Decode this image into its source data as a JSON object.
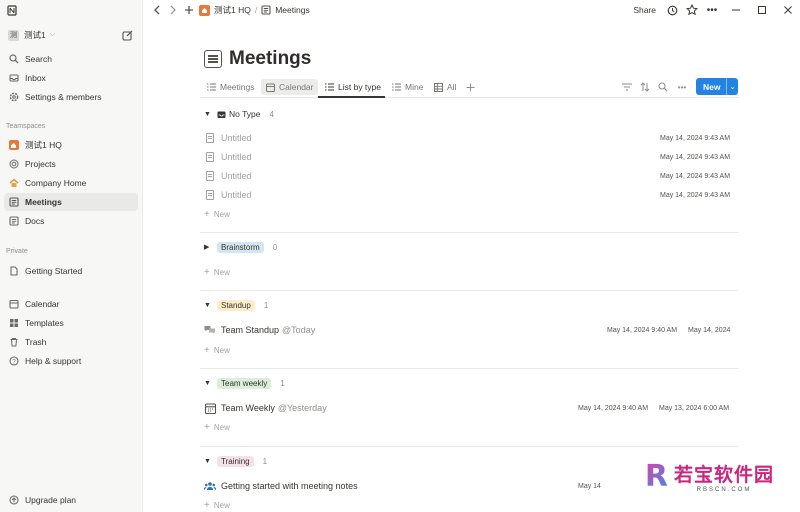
{
  "workspace": {
    "name": "测试1",
    "avatar": "测"
  },
  "sidebar": {
    "top_items": [
      {
        "label": "Search",
        "icon": "search-icon"
      },
      {
        "label": "Inbox",
        "icon": "inbox-icon"
      },
      {
        "label": "Settings & members",
        "icon": "gear-icon"
      }
    ],
    "teamspaces_label": "Teamspaces",
    "teamspace": {
      "label": "测试1 HQ"
    },
    "teamspace_items": [
      {
        "label": "Projects"
      },
      {
        "label": "Company Home"
      },
      {
        "label": "Meetings"
      },
      {
        "label": "Docs"
      }
    ],
    "private_label": "Private",
    "private_items": [
      {
        "label": "Getting Started"
      }
    ],
    "bottom_items": [
      {
        "label": "Calendar"
      },
      {
        "label": "Templates"
      },
      {
        "label": "Trash"
      },
      {
        "label": "Help & support"
      }
    ],
    "upgrade": "Upgrade plan"
  },
  "topbar": {
    "breadcrumb_1": "测试1 HQ",
    "separator": "/",
    "breadcrumb_2": "Meetings",
    "share": "Share"
  },
  "page": {
    "title": "Meetings"
  },
  "views": {
    "tabs": [
      "Meetings",
      "Calendar",
      "List by type",
      "Mine",
      "All"
    ],
    "new_label": "New"
  },
  "groups": {
    "no_type": {
      "label": "No Type",
      "count": "4",
      "rows": [
        {
          "name": "Untitled",
          "date": "May 14, 2024 9:43 AM"
        },
        {
          "name": "Untitled",
          "date": "May 14, 2024 9:43 AM"
        },
        {
          "name": "Untitled",
          "date": "May 14, 2024 9:43 AM"
        },
        {
          "name": "Untitled",
          "date": "May 14, 2024 9:43 AM"
        }
      ],
      "new_label": "New"
    },
    "brainstorm": {
      "label": "Brainstorm",
      "count": "0",
      "new_label": "New",
      "color": "#d3e5ef"
    },
    "standup": {
      "label": "Standup",
      "count": "1",
      "color": "#fdecc8",
      "rows": [
        {
          "name": "Team Standup",
          "mention": "@Today",
          "created": "May 14, 2024 9:40 AM",
          "date": "May 14, 2024"
        }
      ],
      "new_label": "New"
    },
    "weekly": {
      "label": "Team weekly",
      "count": "1",
      "color": "#dbeddb",
      "rows": [
        {
          "name": "Team Weekly",
          "mention": "@Yesterday",
          "created": "May 14, 2024 9:40 AM",
          "date": "May 13, 2024 6:00 AM"
        }
      ],
      "new_label": "New"
    },
    "training": {
      "label": "Training",
      "count": "1",
      "color": "#f5e0e9",
      "rows": [
        {
          "name": "Getting started with meeting notes",
          "created": "May 14"
        }
      ],
      "new_label": "New"
    }
  },
  "watermark": {
    "letter": "R",
    "text": "若宝软件园",
    "sub": "RBSCN.COM"
  }
}
